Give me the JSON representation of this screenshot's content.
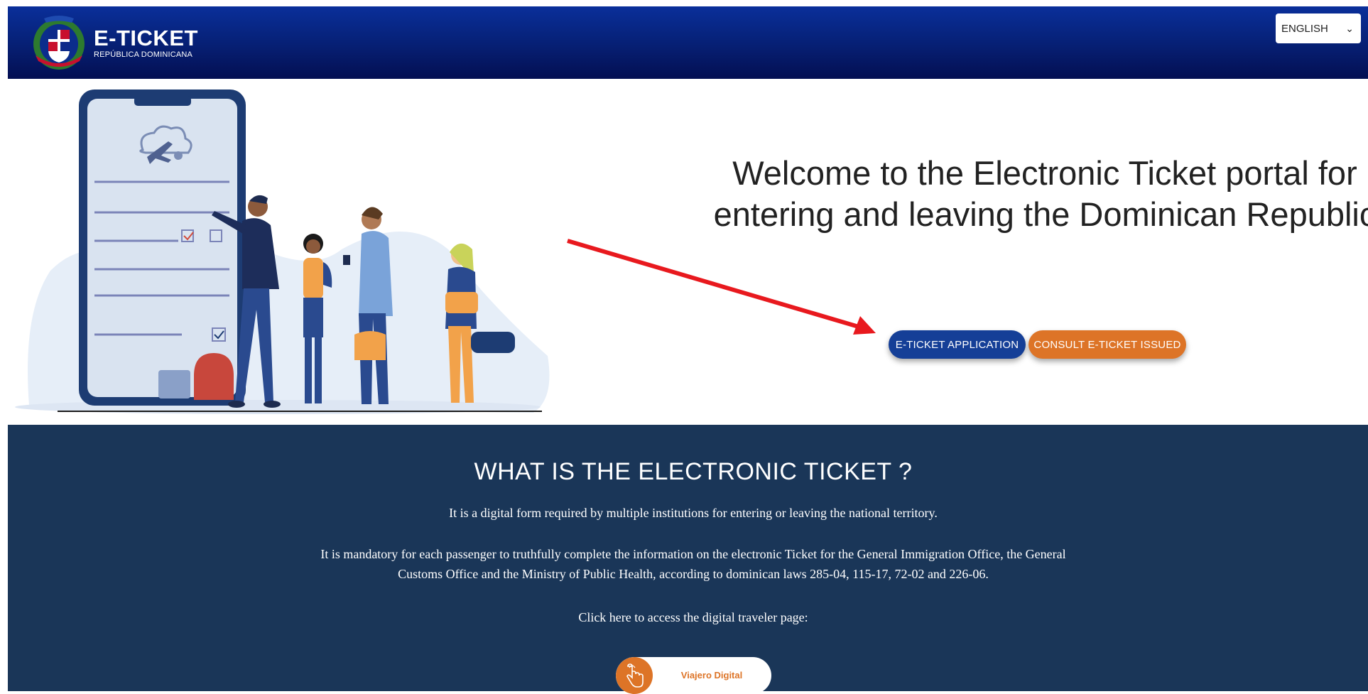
{
  "header": {
    "brand_title": "E-TICKET",
    "brand_subtitle": "REPÚBLICA DOMINICANA",
    "language_selected": "ENGLISH"
  },
  "hero": {
    "title": "Welcome to the Electronic Ticket portal for entering and leaving the Dominican Republic",
    "apply_button": "E-TICKET APPLICATION",
    "consult_button": "CONSULT E-TICKET ISSUED"
  },
  "info": {
    "title": "WHAT IS THE ELECTRONIC TICKET ?",
    "paragraph1": "It is a digital form required by multiple institutions for entering or leaving the national territory.",
    "paragraph2_line1": "It is mandatory for each passenger to truthfully complete the information on the electronic Ticket for the General Immigration Office, the General",
    "paragraph2_line2": "Customs Office and the Ministry of Public Health, according to dominican laws 285-04, 115-17, 72-02 and 226-06.",
    "paragraph3": "Click here to access the digital traveler page:",
    "digital_traveler_button": "Viajero Digital"
  },
  "colors": {
    "header_blue": "#061f73",
    "apply_blue": "#153f97",
    "accent_orange": "#dd7427",
    "info_navy": "#1a3658",
    "arrow_red": "#e8191e"
  },
  "icons": [
    "coat-of-arms-logo",
    "chevron-down-icon",
    "airplane-cloud-icon",
    "checkbox-icon",
    "tap-hand-icon",
    "annotation-arrow"
  ]
}
